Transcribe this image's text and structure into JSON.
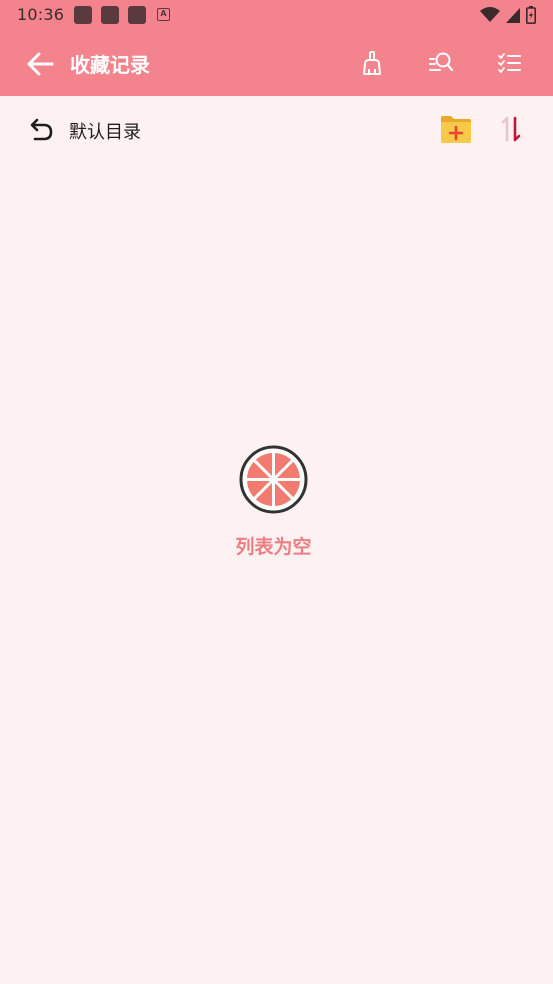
{
  "status_bar": {
    "time": "10:36",
    "notification_letter": "A"
  },
  "toolbar": {
    "title": "收藏记录",
    "icons": [
      "back-arrow-icon",
      "broom-icon",
      "search-list-icon",
      "checklist-icon"
    ]
  },
  "directory": {
    "label": "默认目录"
  },
  "empty_state": {
    "text": "列表为空"
  },
  "colors": {
    "primary": "#f3838c",
    "background": "#fdf1f1",
    "empty_text": "#ec7f84",
    "folder": "#f7c948",
    "sort_accent": "#c0143c"
  }
}
